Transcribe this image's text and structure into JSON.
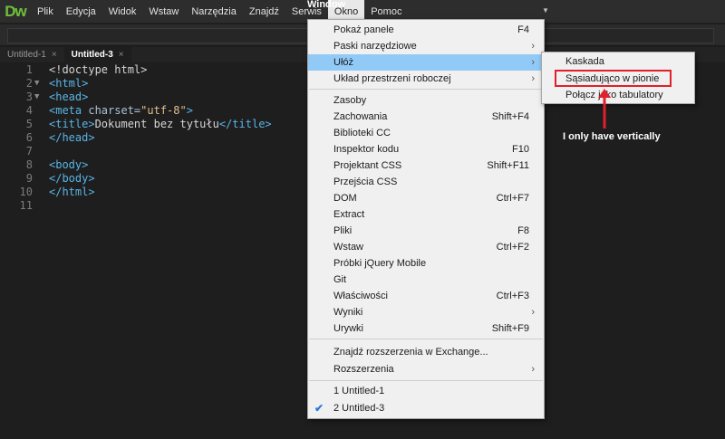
{
  "app": {
    "logo": "Dw"
  },
  "menubar": {
    "items": [
      "Plik",
      "Edycja",
      "Widok",
      "Wstaw",
      "Narzędzia",
      "Znajdź",
      "Serwis",
      "Okno",
      "Pomoc"
    ],
    "active_index": 7
  },
  "annotations": {
    "window_label": "Window",
    "note": "I only have vertically"
  },
  "tabs": [
    {
      "label": "Untitled-1",
      "close": "×",
      "active": false
    },
    {
      "label": "Untitled-3",
      "close": "×",
      "active": true
    }
  ],
  "editor": {
    "line_numbers": [
      "1",
      "2",
      "3",
      "4",
      "5",
      "6",
      "7",
      "8",
      "9",
      "10",
      "11"
    ]
  },
  "dropdown": {
    "group1": [
      {
        "label": "Pokaż panele",
        "shortcut": "F4"
      },
      {
        "label": "Paski narzędziowe",
        "submenu": "›"
      },
      {
        "label": "Ułóż",
        "submenu": "›"
      },
      {
        "label": "Układ przestrzeni roboczej",
        "submenu": "›"
      }
    ],
    "group2": [
      {
        "label": "Zasoby",
        "shortcut": ""
      },
      {
        "label": "Zachowania",
        "shortcut": "Shift+F4"
      },
      {
        "label": "Biblioteki CC",
        "shortcut": ""
      },
      {
        "label": "Inspektor kodu",
        "shortcut": "F10"
      },
      {
        "label": "Projektant CSS",
        "shortcut": "Shift+F11"
      },
      {
        "label": "Przejścia CSS",
        "shortcut": ""
      },
      {
        "label": "DOM",
        "shortcut": "Ctrl+F7"
      },
      {
        "label": "Extract",
        "shortcut": ""
      },
      {
        "label": "Pliki",
        "shortcut": "F8"
      },
      {
        "label": "Wstaw",
        "shortcut": "Ctrl+F2"
      },
      {
        "label": "Próbki jQuery Mobile",
        "shortcut": ""
      },
      {
        "label": "Git",
        "shortcut": ""
      },
      {
        "label": "Właściwości",
        "shortcut": "Ctrl+F3"
      },
      {
        "label": "Wyniki",
        "shortcut": "",
        "submenu": "›"
      },
      {
        "label": "Urywki",
        "shortcut": "Shift+F9"
      }
    ],
    "group3": [
      {
        "label": "Znajdź rozszerzenia w Exchange..."
      },
      {
        "label": "Rozszerzenia",
        "submenu": "›"
      }
    ],
    "group4": [
      {
        "label": "1 Untitled-1",
        "checked": false
      },
      {
        "label": "2 Untitled-3",
        "checked": true,
        "check_glyph": "✔"
      }
    ]
  },
  "submenu": {
    "items": [
      "Kaskada",
      "Sąsiadująco w pionie",
      "Połącz jako tabulatory"
    ]
  },
  "colors": {
    "accent": "#91c9f7",
    "annotation_red": "#e0202a",
    "logo_green": "#6fbf3a"
  }
}
